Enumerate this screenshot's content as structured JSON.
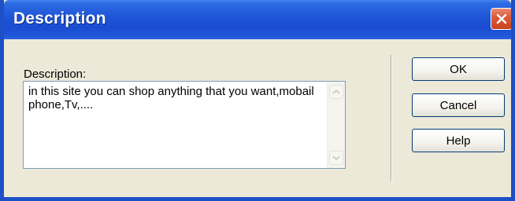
{
  "window": {
    "title": "Description",
    "close_icon": "close-x-icon"
  },
  "form": {
    "label": "Description:",
    "value": "in this site you can shop anything that you want,mobail phone,Tv,...."
  },
  "buttons": {
    "ok": "OK",
    "cancel": "Cancel",
    "help": "Help"
  },
  "colors": {
    "titlebar": "#1e54d6",
    "close_button": "#dd5b3a",
    "dialog_background": "#ece9d8"
  }
}
